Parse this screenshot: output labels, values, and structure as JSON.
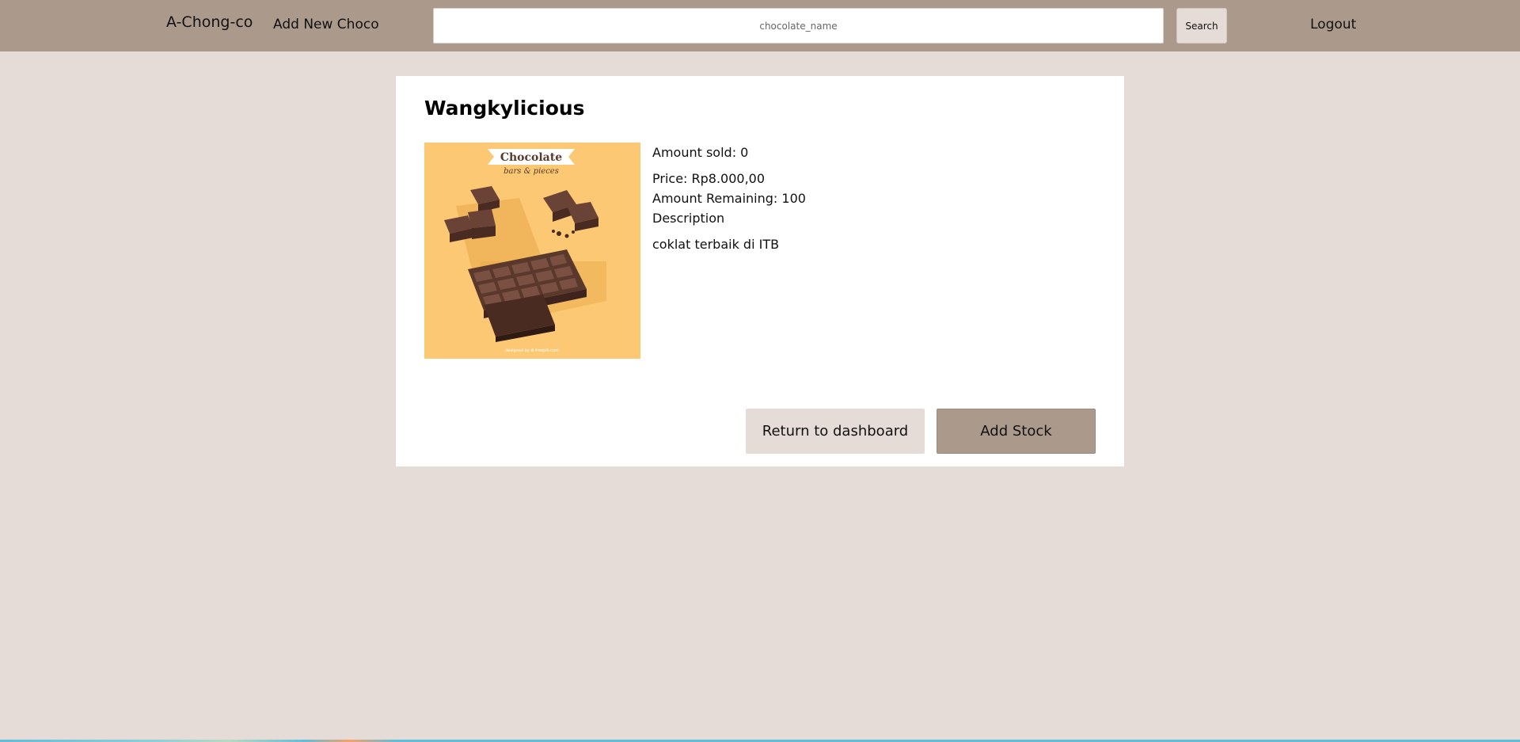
{
  "navbar": {
    "brand": "A-Chong-co",
    "add_new_label": "Add New Choco",
    "search": {
      "placeholder": "chocolate_name",
      "value": ""
    },
    "search_button_label": "Search",
    "logout_label": "Logout"
  },
  "product": {
    "name": "Wangkylicious",
    "image": {
      "banner_title": "Chocolate",
      "banner_subtitle": "bars & pieces",
      "credit": "designed by ✿ freepik.com"
    },
    "amount_sold": "Amount sold: 0",
    "price": "Price: Rp8.000,00",
    "amount_remaining": "Amount Remaining: 100",
    "description_label": "Description",
    "description": "coklat terbaik di ITB"
  },
  "actions": {
    "return_label": "Return to dashboard",
    "add_stock_label": "Add Stock"
  },
  "colors": {
    "navbar_bg": "#ab9a8c",
    "page_bg": "#e5dcd7",
    "card_bg": "#ffffff",
    "accent": "#ab9a8c"
  }
}
